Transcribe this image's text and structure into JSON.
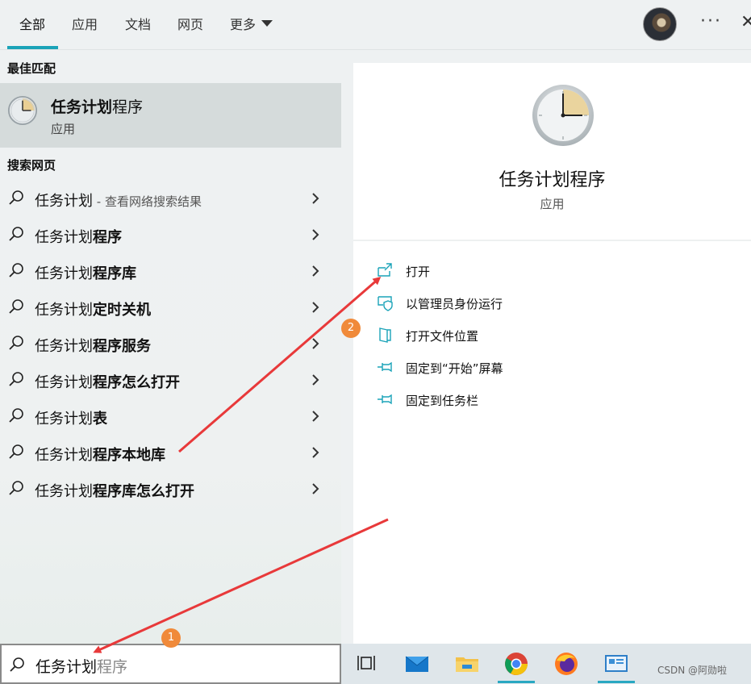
{
  "tabs": [
    {
      "label": "全部",
      "active": true
    },
    {
      "label": "应用"
    },
    {
      "label": "文档"
    },
    {
      "label": "网页"
    },
    {
      "label": "更多"
    }
  ],
  "header": {
    "more_icon": "ellipsis-icon",
    "close_icon": "close-icon"
  },
  "best_match": {
    "heading": "最佳匹配",
    "title_bold": "任务计划",
    "title_rest": "程序",
    "subtitle": "应用"
  },
  "web": {
    "heading": "搜索网页",
    "items": [
      {
        "plain": "任务计划",
        "bold": "",
        "hint": " - 查看网络搜索结果"
      },
      {
        "plain": "任务计划",
        "bold": "程序",
        "hint": ""
      },
      {
        "plain": "任务计划",
        "bold": "程序库",
        "hint": ""
      },
      {
        "plain": "任务计划",
        "bold": "定时关机",
        "hint": ""
      },
      {
        "plain": "任务计划",
        "bold": "程序服务",
        "hint": ""
      },
      {
        "plain": "任务计划",
        "bold": "程序怎么打开",
        "hint": ""
      },
      {
        "plain": "任务计划",
        "bold": "表",
        "hint": ""
      },
      {
        "plain": "任务计划",
        "bold": "程序本地库",
        "hint": ""
      },
      {
        "plain": "任务计划",
        "bold": "程序库怎么打开",
        "hint": ""
      }
    ]
  },
  "detail": {
    "title": "任务计划程序",
    "subtitle": "应用",
    "actions": [
      {
        "label": "打开",
        "icon": "open-icon"
      },
      {
        "label": "以管理员身份运行",
        "icon": "shield-icon"
      },
      {
        "label": "打开文件位置",
        "icon": "file-location-icon"
      },
      {
        "label": "固定到“开始”屏幕",
        "icon": "pin-icon"
      },
      {
        "label": "固定到任务栏",
        "icon": "pin-icon"
      }
    ]
  },
  "search": {
    "typed": "任务计划",
    "suggestion": "程序"
  },
  "taskbar": {
    "apps": [
      "task-view-icon",
      "mail-icon",
      "file-explorer-icon",
      "chrome-icon",
      "firefox-icon",
      "control-panel-icon"
    ],
    "watermark": "CSDN @阿勋啦"
  },
  "annotations": {
    "badge1": "1",
    "badge2": "2"
  },
  "colors": {
    "accent": "#1aa3b8",
    "annotation_arrow": "#e8393a",
    "badge": "#f08a3a"
  }
}
